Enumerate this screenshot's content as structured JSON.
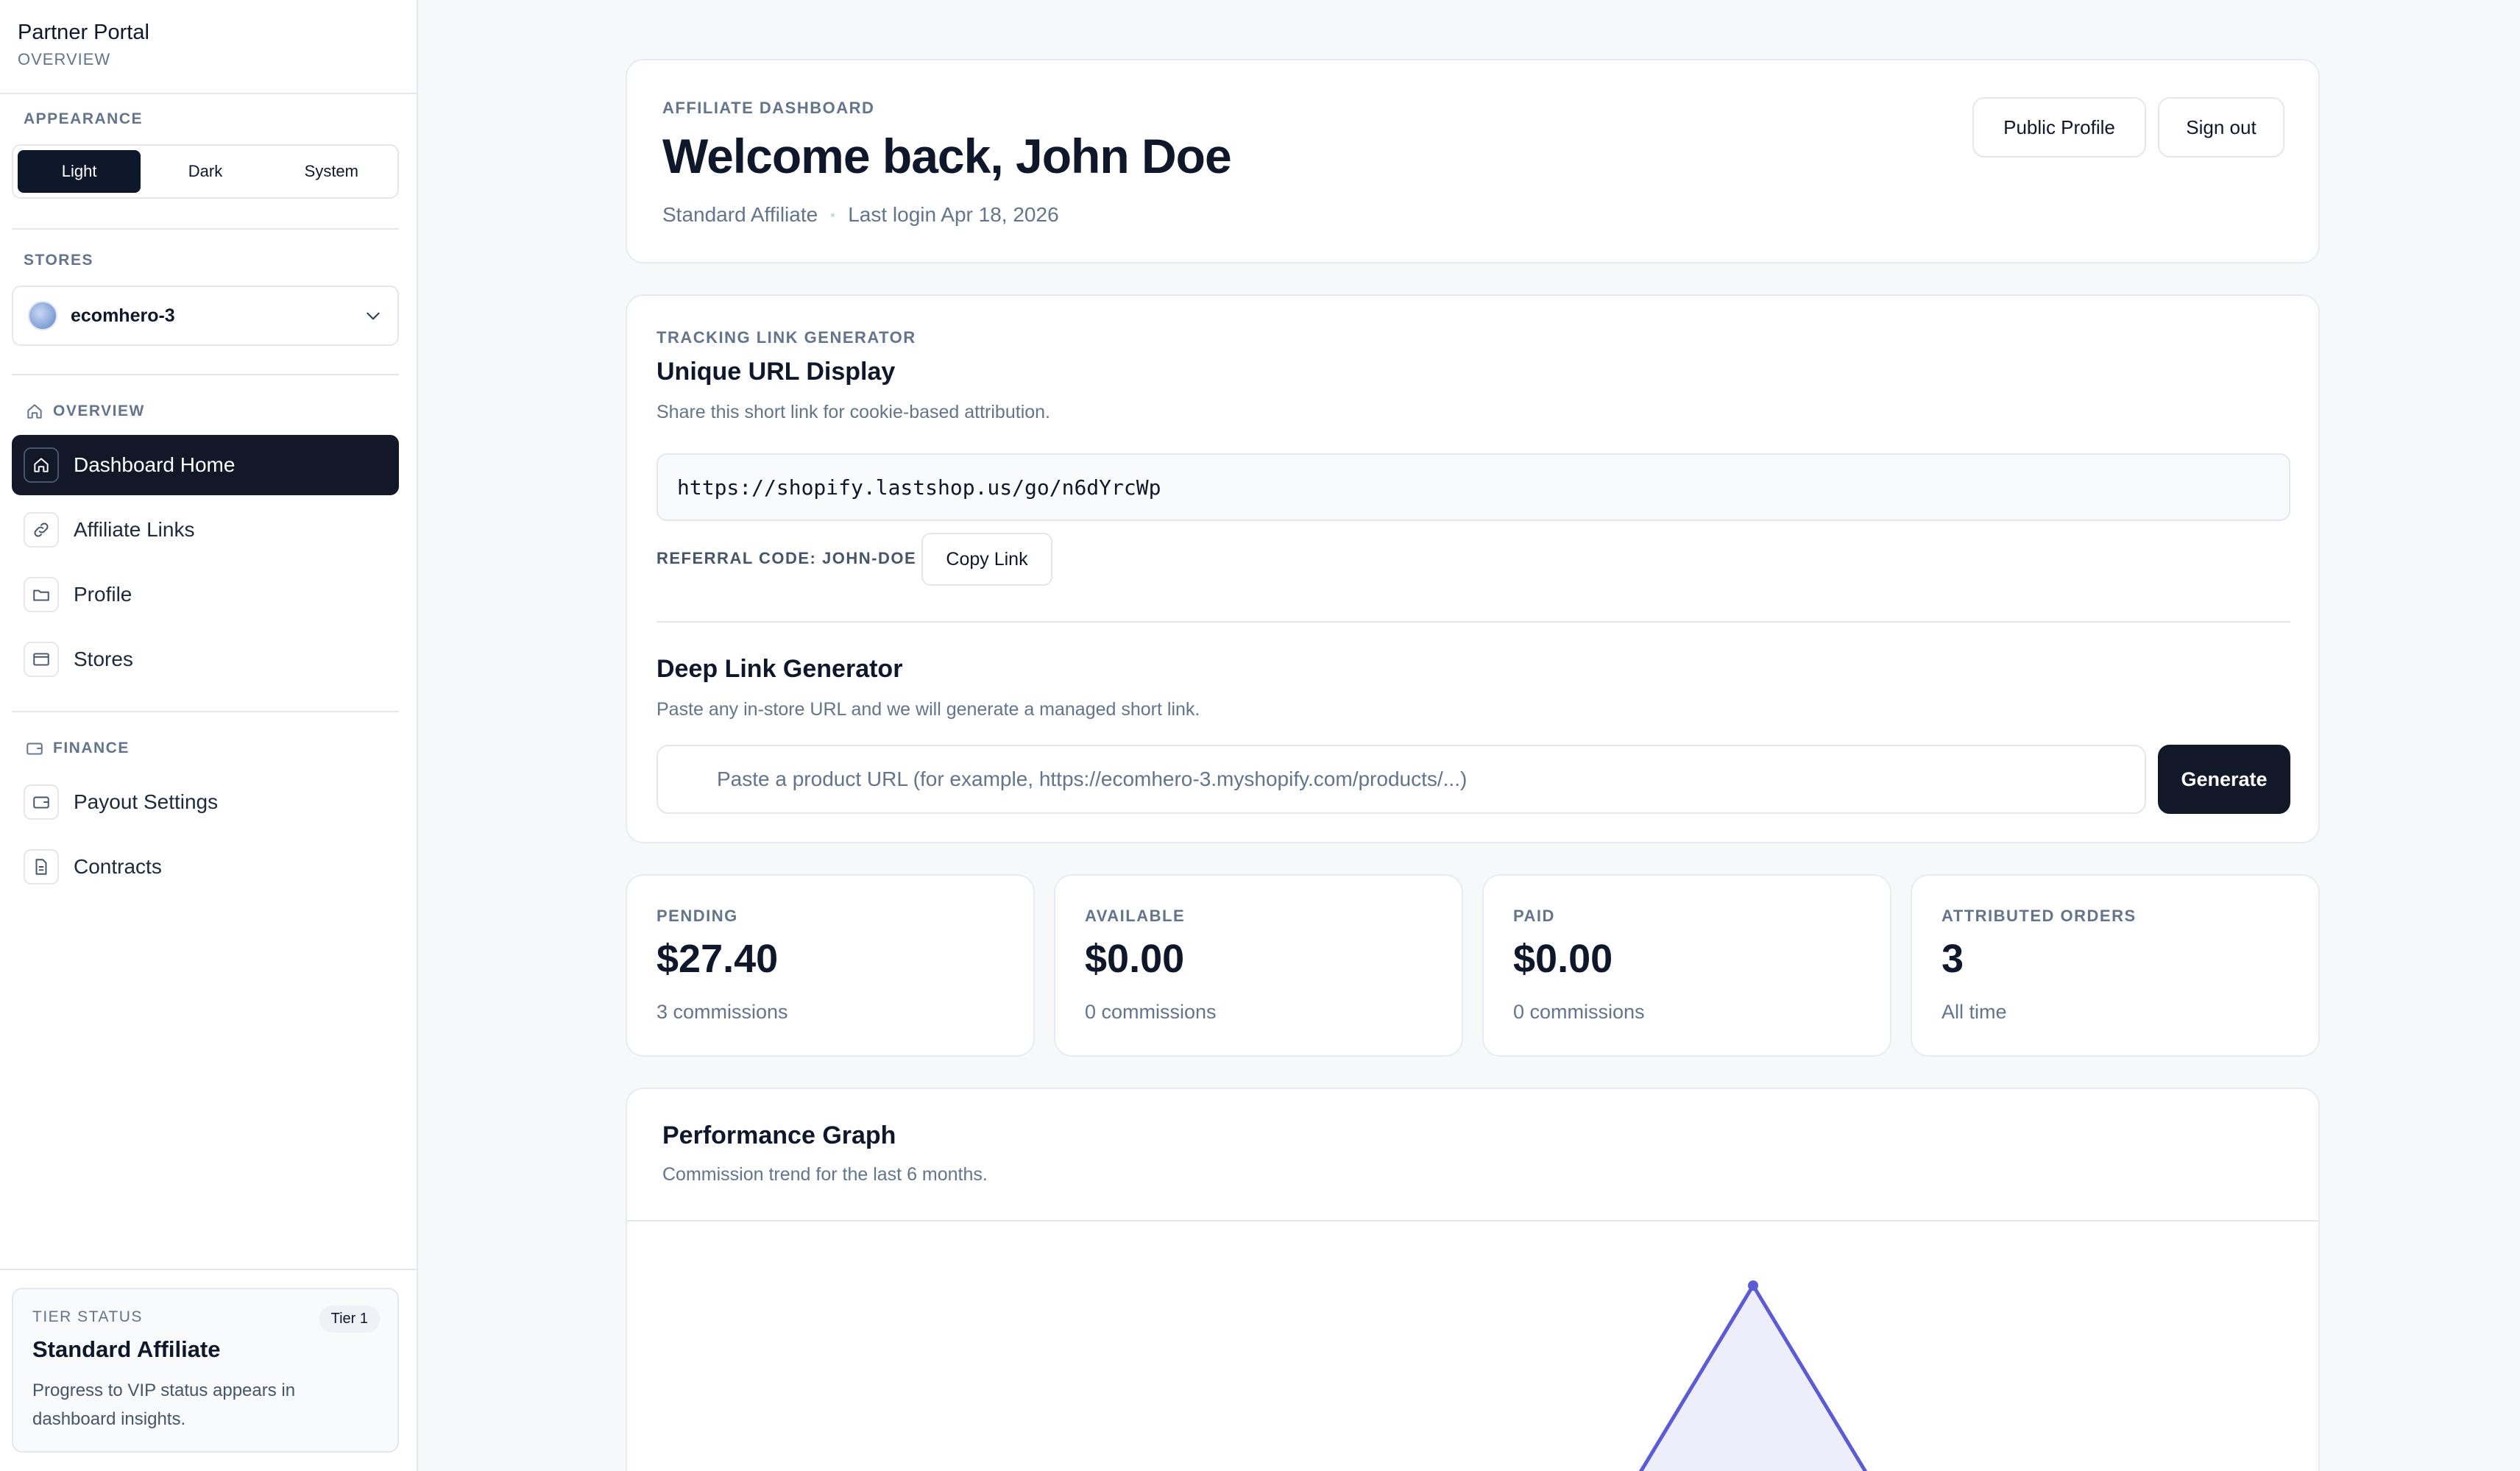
{
  "sidebar": {
    "brand_title": "Partner Portal",
    "brand_subtitle": "OVERVIEW",
    "appearance": {
      "label": "APPEARANCE",
      "options": [
        "Light",
        "Dark",
        "System"
      ],
      "selected": "Light"
    },
    "stores": {
      "label": "STORES",
      "selected_store": "ecomhero-3"
    },
    "overview_section": {
      "label": "OVERVIEW",
      "items": [
        {
          "label": "Dashboard Home",
          "icon": "home-icon",
          "active": true
        },
        {
          "label": "Affiliate Links",
          "icon": "link-icon",
          "active": false
        },
        {
          "label": "Profile",
          "icon": "folder-icon",
          "active": false
        },
        {
          "label": "Stores",
          "icon": "store-icon",
          "active": false
        }
      ]
    },
    "finance_section": {
      "label": "FINANCE",
      "items": [
        {
          "label": "Payout Settings",
          "icon": "wallet-icon",
          "active": false
        },
        {
          "label": "Contracts",
          "icon": "document-icon",
          "active": false
        }
      ]
    },
    "tier": {
      "label": "TIER STATUS",
      "badge": "Tier 1",
      "title": "Standard Affiliate",
      "text": "Progress to VIP status appears in dashboard insights."
    }
  },
  "header": {
    "eyebrow": "AFFILIATE DASHBOARD",
    "title": "Welcome back, John Doe",
    "tier_name": "Standard Affiliate",
    "last_login": "Last login Apr 18, 2026",
    "public_profile_label": "Public Profile",
    "sign_out_label": "Sign out"
  },
  "tracking": {
    "eyebrow": "TRACKING LINK GENERATOR",
    "title": "Unique URL Display",
    "subtitle": "Share this short link for cookie-based attribution.",
    "url": "https://shopify.lastshop.us/go/n6dYrcWp",
    "referral_code": "REFERRAL CODE: JOHN-DOE",
    "copy_label": "Copy Link",
    "deep_title": "Deep Link Generator",
    "deep_subtitle": "Paste any in-store URL and we will generate a managed short link.",
    "deep_placeholder": "Paste a product URL (for example, https://ecomhero-3.myshopify.com/products/...)",
    "generate_label": "Generate"
  },
  "stats": [
    {
      "label": "PENDING",
      "value": "$27.40",
      "note": "3 commissions"
    },
    {
      "label": "AVAILABLE",
      "value": "$0.00",
      "note": "0 commissions"
    },
    {
      "label": "PAID",
      "value": "$0.00",
      "note": "0 commissions"
    },
    {
      "label": "ATTRIBUTED ORDERS",
      "value": "3",
      "note": "All time"
    }
  ],
  "performance": {
    "title": "Performance Graph",
    "subtitle": "Commission trend for the last 6 months.",
    "line_color": "#5b5bd6",
    "fill_color": "#eeeefb"
  }
}
